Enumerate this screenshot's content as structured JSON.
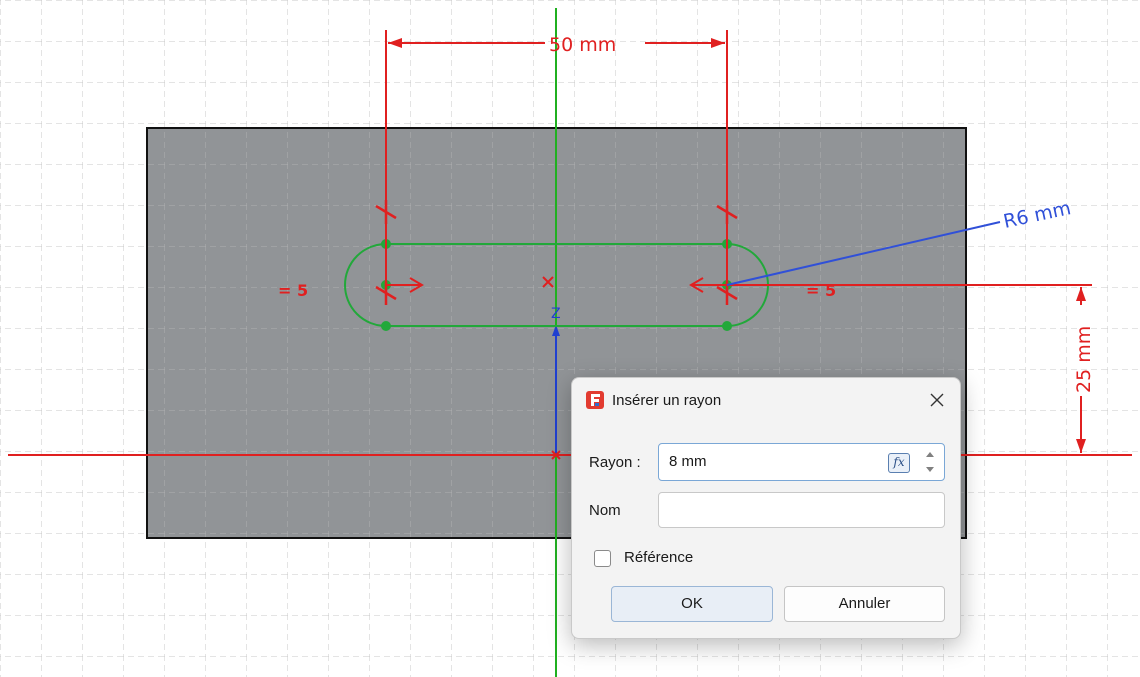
{
  "sketch": {
    "dimension_width": "50 mm",
    "dimension_height": "25 mm",
    "radius_annotation": "R6 mm",
    "equal_constraint_left": "= 5",
    "equal_constraint_right": "= 5",
    "axis_label": "Z"
  },
  "colors": {
    "grid": "#c8c8c8",
    "part_fill": "#8d9194",
    "dimension": "#e02020",
    "sketch_geometry": "#22a83a",
    "axis_vertical": "#20b020",
    "axis_horizontal": "#e02020",
    "z_axis": "#2040d0",
    "radius_leader": "#3050d8"
  },
  "dialog": {
    "title": "Insérer un rayon",
    "radius_label": "Rayon :",
    "radius_value": "8 mm",
    "fx_label": "fx",
    "name_label": "Nom",
    "name_value": "",
    "reference_label": "Référence",
    "reference_checked": false,
    "ok_label": "OK",
    "cancel_label": "Annuler"
  }
}
